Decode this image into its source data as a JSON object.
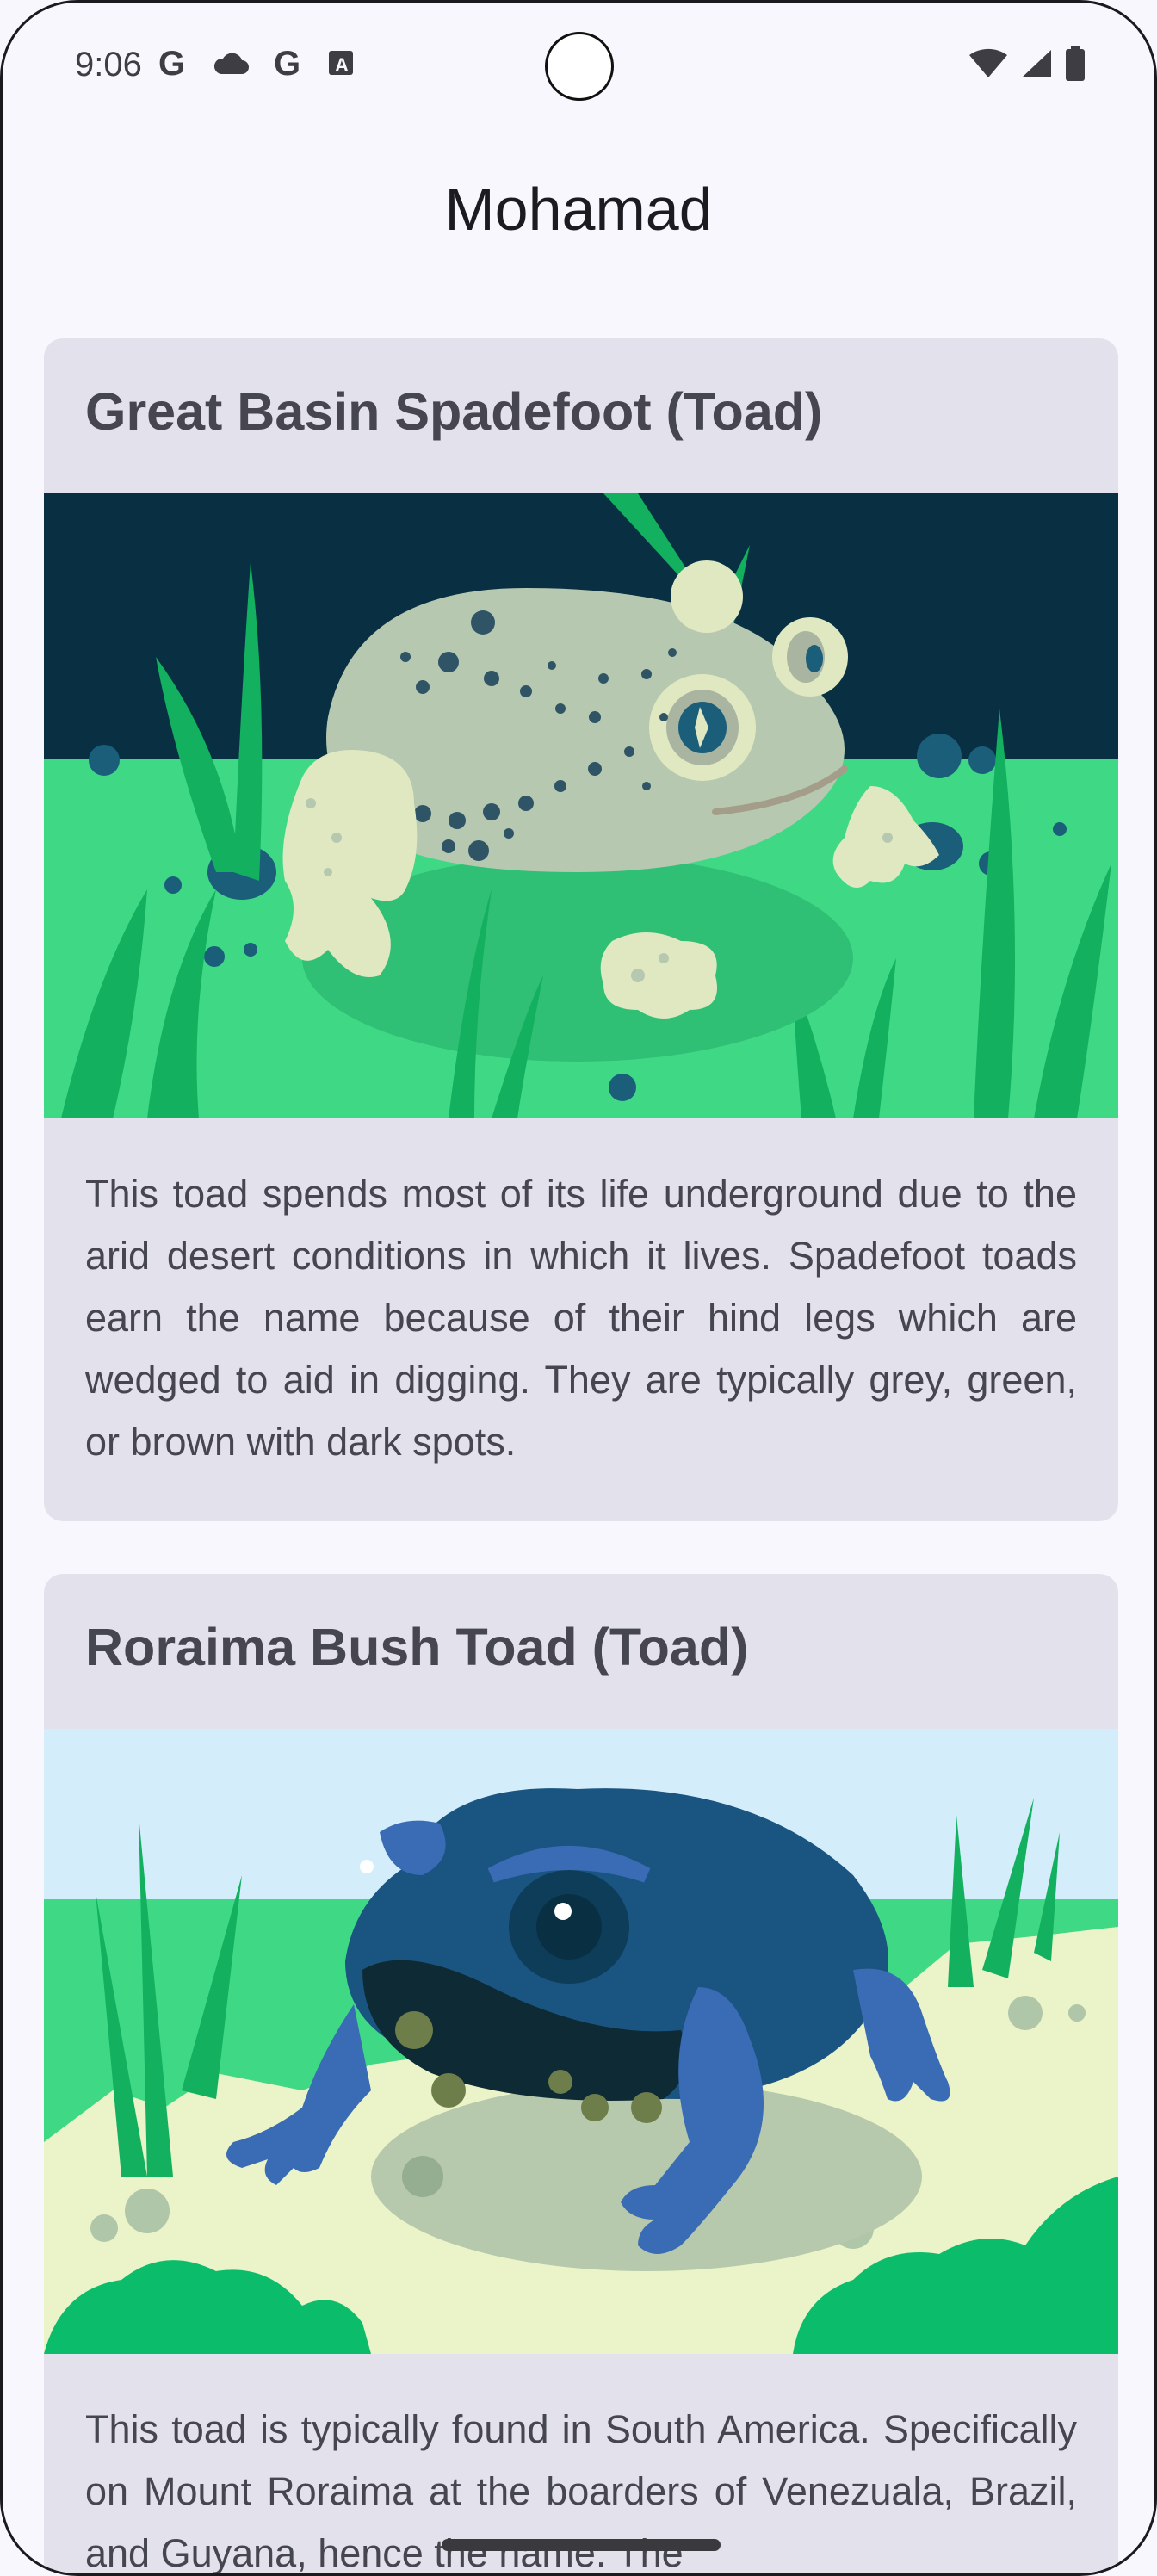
{
  "status_bar": {
    "time": "9:06",
    "left_icons": [
      "google-g-icon",
      "cloud-icon",
      "google-g-icon",
      "translate-a-icon"
    ],
    "right_icons": [
      "wifi-icon",
      "cellular-signal-icon",
      "battery-icon"
    ]
  },
  "app": {
    "title": "Mohamad"
  },
  "cards": [
    {
      "title": "Great Basin Spadefoot (Toad)",
      "image_icon": "spadefoot-toad-illustration",
      "description": "This toad spends most of its life underground due to the arid desert conditions in which it lives. Spadefoot toads earn the name because of their hind legs which are wedged to aid in digging. They are typically grey, green, or brown with dark spots."
    },
    {
      "title": "Roraima Bush Toad (Toad)",
      "image_icon": "bush-toad-illustration",
      "description": "This toad is typically found in South America. Specifically on Mount Roraima at the boarders of Venezuala, Brazil, and Guyana, hence the name. The"
    }
  ],
  "colors": {
    "background": "#f8f7fd",
    "card": "#e3e2ec",
    "text": "#45464f"
  }
}
